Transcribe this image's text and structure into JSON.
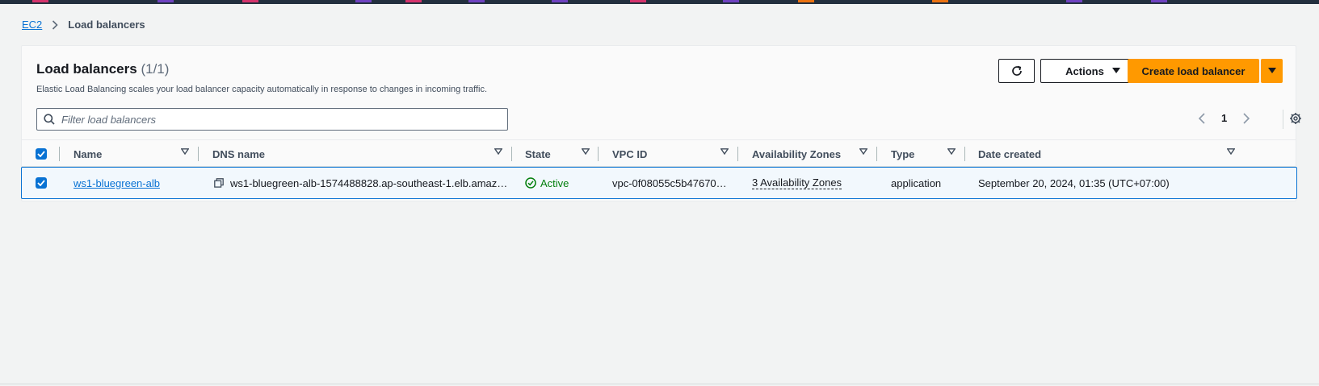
{
  "colors": {
    "primary": "#ff9900",
    "link": "#0972d3",
    "success": "#037f0c",
    "text": "#16191f"
  },
  "breadcrumb": {
    "root": "EC2",
    "current": "Load balancers"
  },
  "panel": {
    "title": "Load balancers",
    "count": "(1/1)",
    "description": "Elastic Load Balancing scales your load balancer capacity automatically in response to changes in incoming traffic."
  },
  "toolbar": {
    "refresh_icon": "refresh-icon",
    "actions_label": "Actions",
    "create_label": "Create load balancer"
  },
  "filter": {
    "placeholder": "Filter load balancers"
  },
  "pagination": {
    "current_page": "1"
  },
  "table": {
    "headers": {
      "name": "Name",
      "dns": "DNS name",
      "state": "State",
      "vpc": "VPC ID",
      "az": "Availability Zones",
      "type": "Type",
      "date": "Date created"
    },
    "rows": [
      {
        "selected": true,
        "name": "ws1-bluegreen-alb",
        "dns": "ws1-bluegreen-alb-1574488828.ap-southeast-1.elb.amaz…",
        "state": "Active",
        "vpc": "vpc-0f08055c5b47670…",
        "az": "3 Availability Zones",
        "type": "application",
        "date": "September 20, 2024, 01:35 (UTC+07:00)"
      }
    ]
  }
}
